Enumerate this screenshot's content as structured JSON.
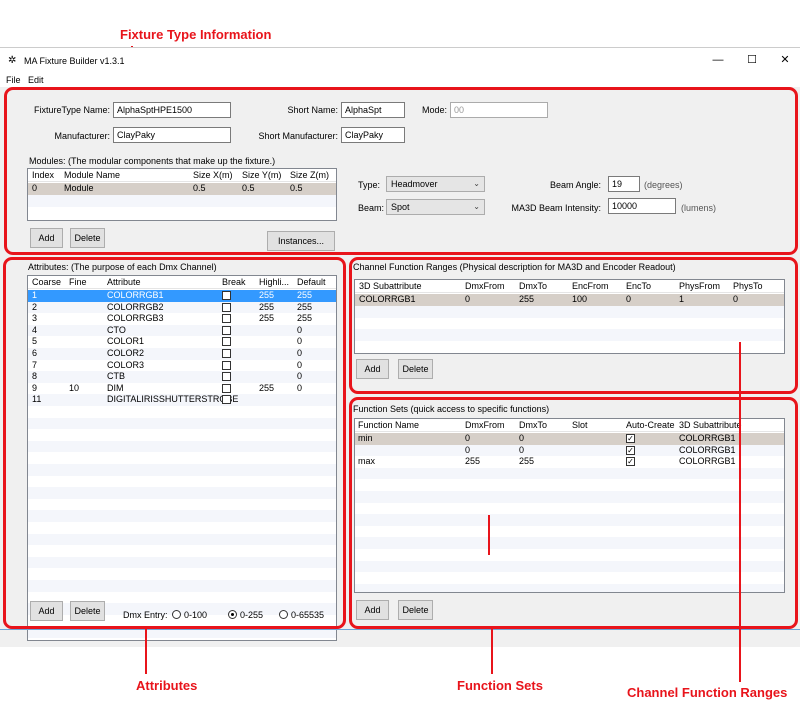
{
  "annotations": {
    "fixture_type_info": "Fixture Type Information",
    "attributes": "Attributes",
    "function_sets": "Function Sets",
    "channel_function_ranges": "Channel Function Ranges"
  },
  "window": {
    "title": "MA Fixture Builder v1.3.1",
    "minimize": "—",
    "maximize": "☐",
    "close": "✕"
  },
  "menu": {
    "file": "File",
    "edit": "Edit"
  },
  "fixture": {
    "name_label": "FixtureType Name:",
    "name_value": "AlphaSptHPE1500",
    "short_name_label": "Short Name:",
    "short_name_value": "AlphaSpt",
    "mode_label": "Mode:",
    "mode_placeholder": "00",
    "manufacturer_label": "Manufacturer:",
    "manufacturer_value": "ClayPaky",
    "short_manufacturer_label": "Short Manufacturer:",
    "short_manufacturer_value": "ClayPaky",
    "modules_caption": "Modules: (The modular components that make up the fixture.)",
    "modules_columns": [
      "Index",
      "Module Name",
      "Size X(m)",
      "Size Y(m)",
      "Size Z(m)"
    ],
    "modules_rows": [
      [
        "0",
        "Module",
        "0.5",
        "0.5",
        "0.5"
      ]
    ],
    "add_label": "Add",
    "delete_label": "Delete",
    "instances_label": "Instances...",
    "type_label": "Type:",
    "type_value": "Headmover",
    "beam_label": "Beam:",
    "beam_value": "Spot",
    "beam_angle_label": "Beam Angle:",
    "beam_angle_value": "19",
    "beam_angle_unit": "(degrees)",
    "intensity_label": "MA3D Beam Intensity:",
    "intensity_value": "10000",
    "intensity_unit": "(lumens)"
  },
  "attributes": {
    "caption": "Attributes: (The purpose of each Dmx Channel)",
    "columns": [
      "Coarse",
      "Fine",
      "Attribute",
      "Break",
      "Highli...",
      "Default"
    ],
    "rows": [
      {
        "coarse": "1",
        "fine": "",
        "attribute": "COLORRGB1",
        "brk": false,
        "highlight": "255",
        "default": "255"
      },
      {
        "coarse": "2",
        "fine": "",
        "attribute": "COLORRGB2",
        "brk": false,
        "highlight": "255",
        "default": "255"
      },
      {
        "coarse": "3",
        "fine": "",
        "attribute": "COLORRGB3",
        "brk": false,
        "highlight": "255",
        "default": "255"
      },
      {
        "coarse": "4",
        "fine": "",
        "attribute": "CTO",
        "brk": false,
        "highlight": "",
        "default": "0"
      },
      {
        "coarse": "5",
        "fine": "",
        "attribute": "COLOR1",
        "brk": false,
        "highlight": "",
        "default": "0"
      },
      {
        "coarse": "6",
        "fine": "",
        "attribute": "COLOR2",
        "brk": false,
        "highlight": "",
        "default": "0"
      },
      {
        "coarse": "7",
        "fine": "",
        "attribute": "COLOR3",
        "brk": false,
        "highlight": "",
        "default": "0"
      },
      {
        "coarse": "8",
        "fine": "",
        "attribute": "CTB",
        "brk": false,
        "highlight": "",
        "default": "0"
      },
      {
        "coarse": "9",
        "fine": "10",
        "attribute": "DIM",
        "brk": false,
        "highlight": "255",
        "default": "0"
      },
      {
        "coarse": "11",
        "fine": "",
        "attribute": "DIGITALIRISSHUTTERSTROBE",
        "brk": false,
        "highlight": "",
        "default": ""
      }
    ],
    "add_label": "Add",
    "delete_label": "Delete",
    "dmx_entry_label": "Dmx Entry:",
    "dmx_options": [
      "0-100",
      "0-255",
      "0-65535"
    ],
    "dmx_selected": "0-255"
  },
  "channel_ranges": {
    "caption": "Channel Function Ranges (Physical description for MA3D and Encoder Readout)",
    "columns": [
      "3D Subattribute",
      "DmxFrom",
      "DmxTo",
      "EncFrom",
      "EncTo",
      "PhysFrom",
      "PhysTo"
    ],
    "rows": [
      [
        "COLORRGB1",
        "0",
        "255",
        "100",
        "0",
        "1",
        "0"
      ]
    ],
    "add_label": "Add",
    "delete_label": "Delete"
  },
  "function_sets": {
    "caption": "Function Sets (quick access to specific functions)",
    "columns": [
      "Function Name",
      "DmxFrom",
      "DmxTo",
      "Slot",
      "Auto-Create",
      "3D Subattribute"
    ],
    "rows": [
      {
        "name": "min",
        "from": "0",
        "to": "0",
        "slot": "",
        "auto": true,
        "sub": "COLORRGB1"
      },
      {
        "name": "",
        "from": "0",
        "to": "0",
        "slot": "",
        "auto": true,
        "sub": "COLORRGB1"
      },
      {
        "name": "max",
        "from": "255",
        "to": "255",
        "slot": "",
        "auto": true,
        "sub": "COLORRGB1"
      }
    ],
    "add_label": "Add",
    "delete_label": "Delete"
  },
  "colors": {
    "annotation": "#e8141b",
    "selection": "#3399ff",
    "gray_selection": "#d6cfc8"
  }
}
